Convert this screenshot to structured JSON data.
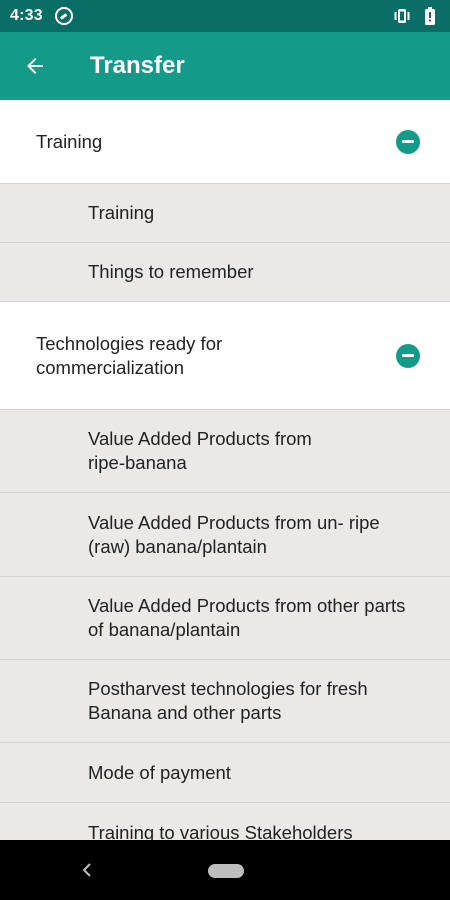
{
  "status_bar": {
    "time": "4:33",
    "icons": [
      "app-notification-icon",
      "vibrate-icon",
      "battery-icon"
    ]
  },
  "app_bar": {
    "title": "Transfer",
    "back_icon": "arrow-back-icon"
  },
  "groups": [
    {
      "label": "Training",
      "expanded": true,
      "items": [
        "Training",
        "Things to remember"
      ]
    },
    {
      "label": "Technologies ready for\ncommercialization",
      "expanded": true,
      "items": [
        "Value Added Products from\nripe-banana",
        "Value Added Products from un- ripe\n(raw) banana/plantain",
        "Value Added Products from other parts\nof banana/plantain",
        "Postharvest technologies for fresh\nBanana and other parts",
        "Mode of payment",
        "Training to various Stakeholders"
      ]
    }
  ],
  "colors": {
    "status_bar": "#0b6e66",
    "app_bar": "#149a88",
    "accent": "#149a88",
    "child_background": "#ebe9e6"
  }
}
